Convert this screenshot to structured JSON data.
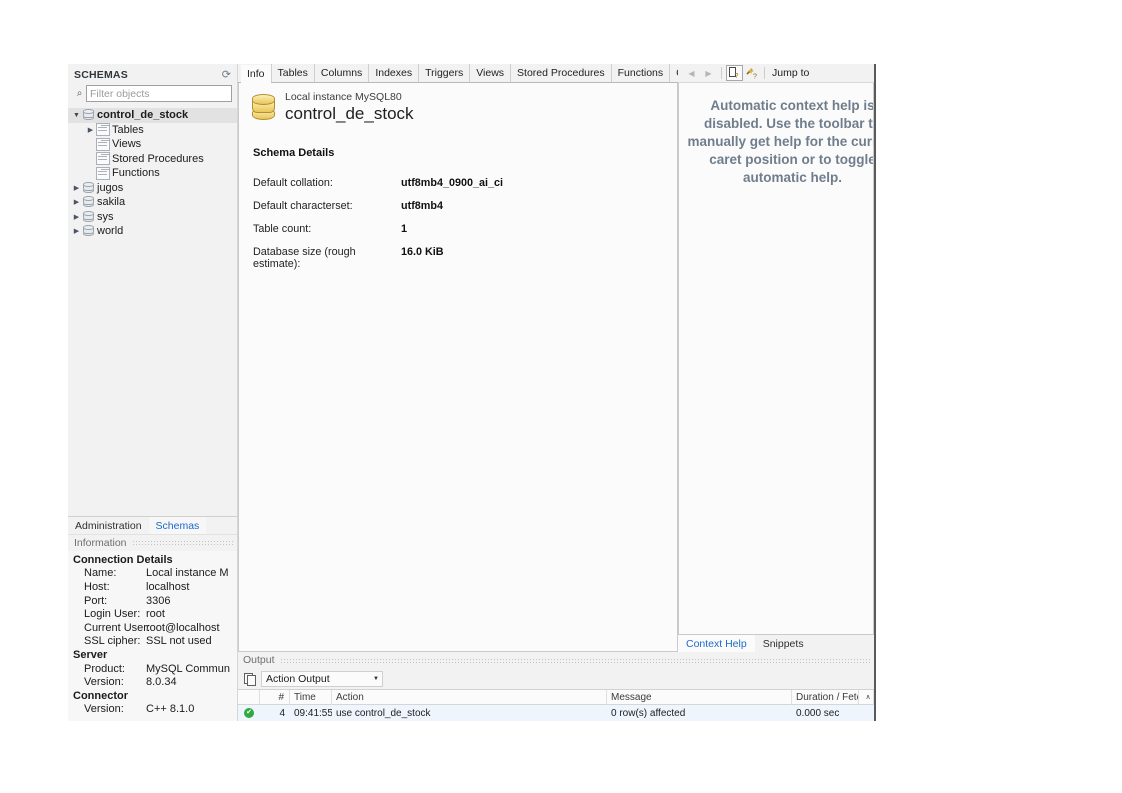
{
  "sidebar": {
    "header_title": "SCHEMAS",
    "refresh_icon": "refresh-icon",
    "filter_placeholder": "Filter objects",
    "tree": [
      {
        "label": "control_de_stock",
        "icon": "database-icon",
        "depth": 0,
        "arrow": "open",
        "bold": true,
        "selected": true
      },
      {
        "label": "Tables",
        "icon": "grid-icon",
        "depth": 1,
        "arrow": "closed",
        "bold": false,
        "selected": false
      },
      {
        "label": "Views",
        "icon": "grid-icon",
        "depth": 1,
        "arrow": "none",
        "bold": false,
        "selected": false
      },
      {
        "label": "Stored Procedures",
        "icon": "grid-icon",
        "depth": 1,
        "arrow": "none",
        "bold": false,
        "selected": false
      },
      {
        "label": "Functions",
        "icon": "grid-icon",
        "depth": 1,
        "arrow": "none",
        "bold": false,
        "selected": false
      },
      {
        "label": "jugos",
        "icon": "database-icon",
        "depth": 0,
        "arrow": "closed",
        "bold": false,
        "selected": false
      },
      {
        "label": "sakila",
        "icon": "database-icon",
        "depth": 0,
        "arrow": "closed",
        "bold": false,
        "selected": false
      },
      {
        "label": "sys",
        "icon": "database-icon",
        "depth": 0,
        "arrow": "closed",
        "bold": false,
        "selected": false
      },
      {
        "label": "world",
        "icon": "database-icon",
        "depth": 0,
        "arrow": "closed",
        "bold": false,
        "selected": false
      }
    ],
    "bottom_tabs": [
      {
        "label": "Administration",
        "active": false
      },
      {
        "label": "Schemas",
        "active": true
      }
    ],
    "information_label": "Information",
    "connection": {
      "groups": [
        {
          "title": "Connection Details",
          "rows": [
            {
              "key": "Name:",
              "value": "Local instance M"
            },
            {
              "key": "Host:",
              "value": "localhost"
            },
            {
              "key": "Port:",
              "value": "3306"
            },
            {
              "key": "Login User:",
              "value": "root"
            },
            {
              "key": "Current User:",
              "value": "root@localhost"
            },
            {
              "key": "SSL cipher:",
              "value": "SSL not used"
            }
          ]
        },
        {
          "title": "Server",
          "rows": [
            {
              "key": "Product:",
              "value": "MySQL Commun"
            },
            {
              "key": "Version:",
              "value": "8.0.34"
            }
          ]
        },
        {
          "title": "Connector",
          "rows": [
            {
              "key": "Version:",
              "value": "C++ 8.1.0"
            }
          ]
        }
      ]
    }
  },
  "editor": {
    "tabs": [
      {
        "label": "Info",
        "active": true
      },
      {
        "label": "Tables",
        "active": false
      },
      {
        "label": "Columns",
        "active": false
      },
      {
        "label": "Indexes",
        "active": false
      },
      {
        "label": "Triggers",
        "active": false
      },
      {
        "label": "Views",
        "active": false
      },
      {
        "label": "Stored Procedures",
        "active": false
      },
      {
        "label": "Functions",
        "active": false
      },
      {
        "label": "Grants",
        "active": false
      }
    ],
    "tab_scroll_left": "◀",
    "tab_scroll_right": "▶",
    "schema_header": {
      "instance": "Local instance MySQL80",
      "name": "control_de_stock",
      "icon": "database-icon"
    },
    "details_title": "Schema Details",
    "details": [
      {
        "key": "Default collation:",
        "value": "utf8mb4_0900_ai_ci"
      },
      {
        "key": "Default characterset:",
        "value": "utf8mb4"
      },
      {
        "key": "Table count:",
        "value": "1"
      },
      {
        "key": "Database size (rough estimate):",
        "value": "16.0 KiB"
      }
    ]
  },
  "help": {
    "toolbar": {
      "back_icon": "back-arrow-icon",
      "forward_icon": "forward-arrow-icon",
      "manual_help_icon": "help-document-icon",
      "auto_help_icon": "help-wand-icon",
      "jump_to_label": "Jump to"
    },
    "message": "Automatic context help is disabled. Use the toolbar to manually get help for the current caret position or to toggle automatic help.",
    "tabs": [
      {
        "label": "Context Help",
        "active": true
      },
      {
        "label": "Snippets",
        "active": false
      }
    ]
  },
  "output": {
    "panel_label": "Output",
    "copy_icon": "copy-icon",
    "selected_view": "Action Output",
    "caret_icon": "chevron-down-icon",
    "columns": [
      "",
      "#",
      "Time",
      "Action",
      "Message",
      "Duration / Fetch",
      "∧"
    ],
    "rows": [
      {
        "status": "success",
        "status_glyph": "✔",
        "num": "4",
        "time": "09:41:55",
        "action": "use control_de_stock",
        "message": "0 row(s) affected",
        "duration": "0.000 sec"
      }
    ]
  },
  "colors": {
    "accent_link": "#1b6ac9",
    "help_text": "#6f7d8c",
    "success": "#2eaa3f",
    "db_icon_gold": "#e8c65a",
    "row_highlight": "#eff5fc"
  }
}
